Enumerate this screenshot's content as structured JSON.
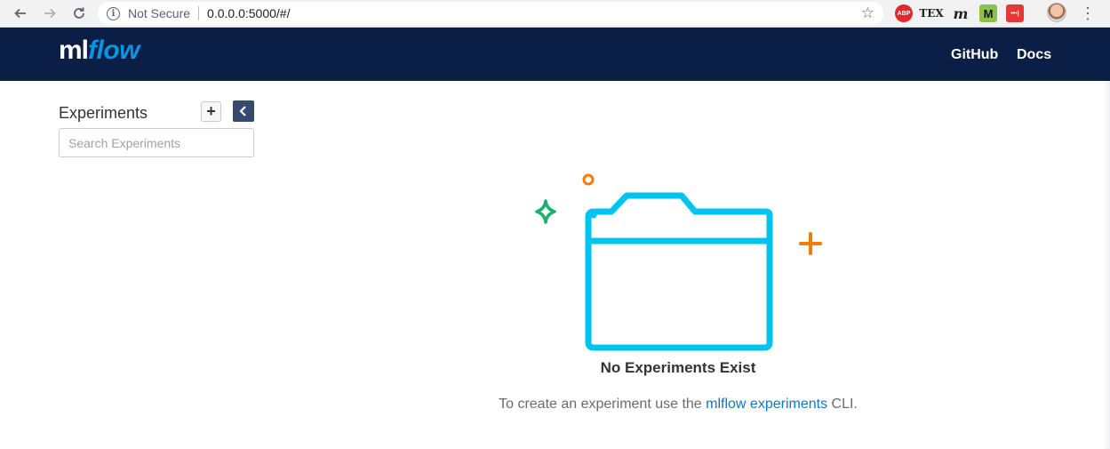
{
  "browser": {
    "secure_label": "Not Secure",
    "url": "0.0.0.0:5000/#/",
    "extensions": [
      {
        "name": "adblock-plus",
        "label": "ABP"
      },
      {
        "name": "tex",
        "label": "TEX"
      },
      {
        "name": "m-italic",
        "label": "m"
      },
      {
        "name": "m-green",
        "label": "M"
      },
      {
        "name": "red-ext",
        "label": "•••|"
      }
    ]
  },
  "header": {
    "logo_ml": "ml",
    "logo_flow": "flow",
    "links": {
      "github": "GitHub",
      "docs": "Docs"
    }
  },
  "sidebar": {
    "title": "Experiments",
    "add_label": "+",
    "search_placeholder": "Search Experiments"
  },
  "empty_state": {
    "title": "No Experiments Exist",
    "desc_before": "To create an experiment use the ",
    "desc_link": "mlflow experiments",
    "desc_after": " CLI."
  },
  "colors": {
    "header_bg": "#0b1e45",
    "folder": "#00c4f0",
    "sparkle_green": "#15b16d",
    "accent_orange": "#f57c00",
    "link": "#1576bd"
  }
}
